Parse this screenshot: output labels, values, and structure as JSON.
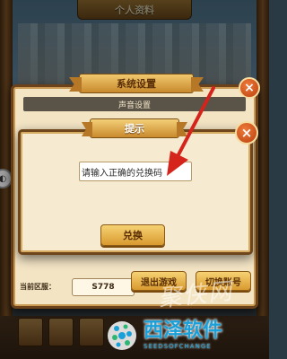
{
  "background": {
    "top_tab_title": "个人资料"
  },
  "settings_dialog": {
    "title": "系统设置",
    "sound_section_label": "声音设置",
    "close_glyph": "×",
    "region_label": "当前区服：",
    "region_value": "S778",
    "exit_game_label": "退出游戏",
    "switch_account_label": "切换账号"
  },
  "prompt_dialog": {
    "title": "提示",
    "close_glyph": "×",
    "code_input_value": "请输入正确的兑换码",
    "redeem_button_label": "兑换"
  },
  "watermark": {
    "brand_name": "西泽软件",
    "brand_url": "SEEDSOFCHANGE",
    "cursive_mark": "聚侠网"
  },
  "annotation": {
    "arrow_color": "#d4241c"
  },
  "colors": {
    "panel_bg": "#f6ead1",
    "panel_border": "#6f451b",
    "gold_button": "#e6b44f",
    "close_button": "#d0571e",
    "brand_blue": "#1aa0d8"
  }
}
